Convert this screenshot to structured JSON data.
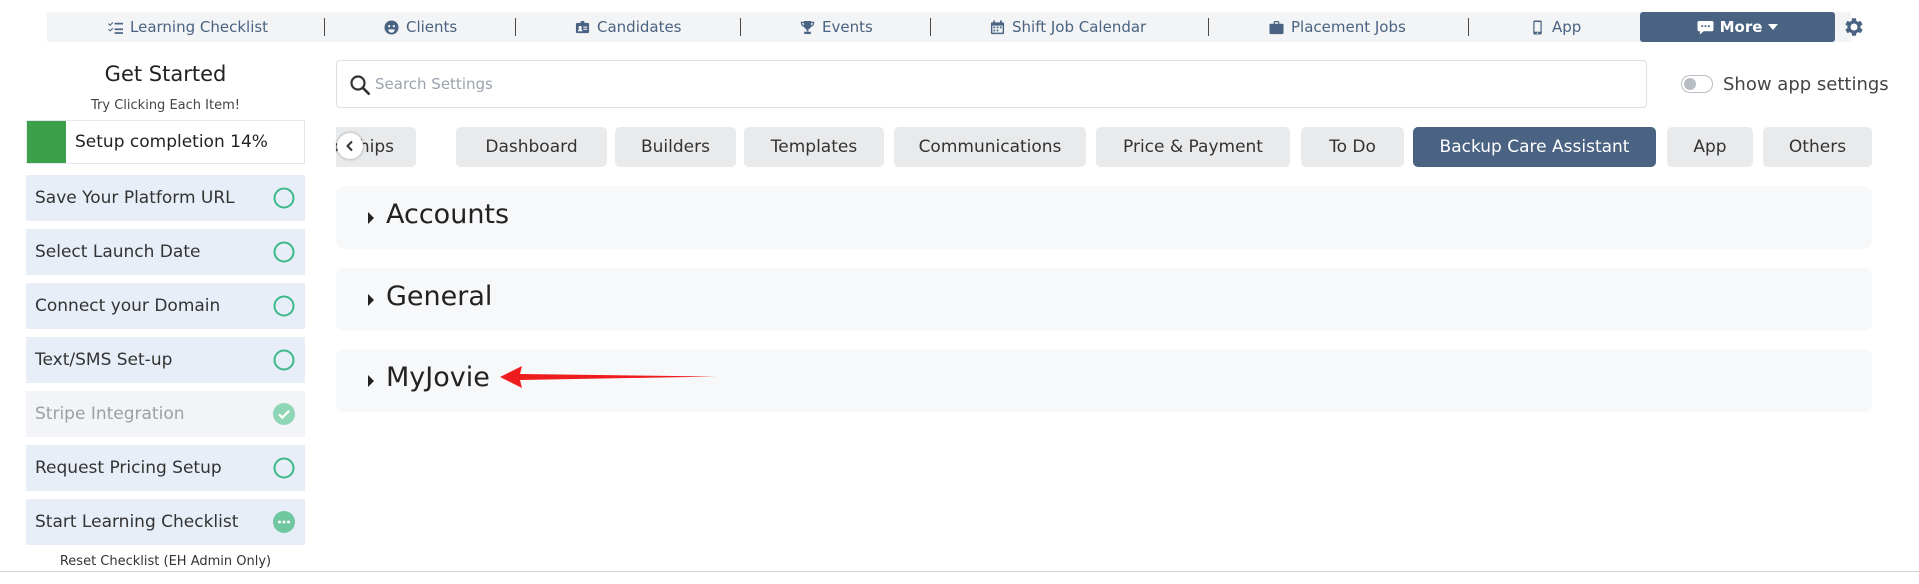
{
  "topnav": {
    "items": [
      {
        "label": "Learning Checklist",
        "icon": "checklist-icon"
      },
      {
        "label": "Clients",
        "icon": "face-icon"
      },
      {
        "label": "Candidates",
        "icon": "id-badge-icon"
      },
      {
        "label": "Events",
        "icon": "trophy-icon"
      },
      {
        "label": "Shift Job Calendar",
        "icon": "calendar-icon"
      },
      {
        "label": "Placement Jobs",
        "icon": "briefcase-icon"
      },
      {
        "label": "App",
        "icon": "phone-icon"
      }
    ],
    "more_label": "More",
    "settings_icon": "gear-icon"
  },
  "sidebar": {
    "title": "Get Started",
    "subtitle": "Try Clicking Each Item!",
    "progress_label": "Setup completion 14%",
    "progress_percent": 14,
    "items": [
      {
        "label": "Save Your Platform URL",
        "status": "todo"
      },
      {
        "label": "Select Launch Date",
        "status": "todo"
      },
      {
        "label": "Connect your Domain",
        "status": "todo"
      },
      {
        "label": "Text/SMS Set-up",
        "status": "todo"
      },
      {
        "label": "Stripe Integration",
        "status": "done"
      },
      {
        "label": "Request Pricing Setup",
        "status": "todo"
      },
      {
        "label": "Start Learning Checklist",
        "status": "in-progress"
      }
    ],
    "reset_label": "Reset Checklist (EH Admin Only)"
  },
  "search": {
    "placeholder": "Search Settings",
    "value": ""
  },
  "app_settings_toggle": {
    "label": "Show app settings",
    "on": false
  },
  "tabs": [
    {
      "label": "onships",
      "active": false
    },
    {
      "label": "Dashboard",
      "active": false
    },
    {
      "label": "Builders",
      "active": false
    },
    {
      "label": "Templates",
      "active": false
    },
    {
      "label": "Communications",
      "active": false
    },
    {
      "label": "Price & Payment",
      "active": false
    },
    {
      "label": "To Do",
      "active": false
    },
    {
      "label": "Backup Care Assistant",
      "active": true
    },
    {
      "label": "App",
      "active": false
    },
    {
      "label": "Others",
      "active": false
    }
  ],
  "sections": [
    {
      "title": "Accounts"
    },
    {
      "title": "General"
    },
    {
      "title": "MyJovie"
    }
  ],
  "colors": {
    "accent": "#4a6382",
    "progress": "#3ba049",
    "status_green": "#3cb88a",
    "arrow": "#ee1c1c"
  }
}
